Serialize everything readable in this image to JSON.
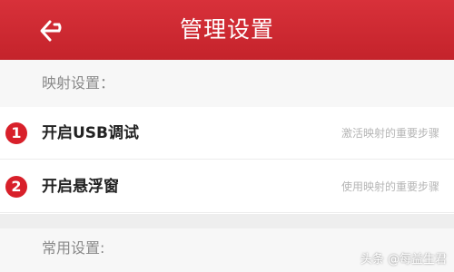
{
  "header": {
    "title": "管理设置",
    "back_icon": "back-arrow-icon",
    "color": "#c9252e"
  },
  "sections": [
    {
      "label": "映射设置：",
      "items": [
        {
          "badge": "1",
          "label": "开启USB调试",
          "description": "激活映射的重要步骤"
        },
        {
          "badge": "2",
          "label": "开启悬浮窗",
          "description": "使用映射的重要步骤"
        }
      ]
    },
    {
      "label": "常用设置:"
    }
  ],
  "watermark": "头条 @每益生君"
}
